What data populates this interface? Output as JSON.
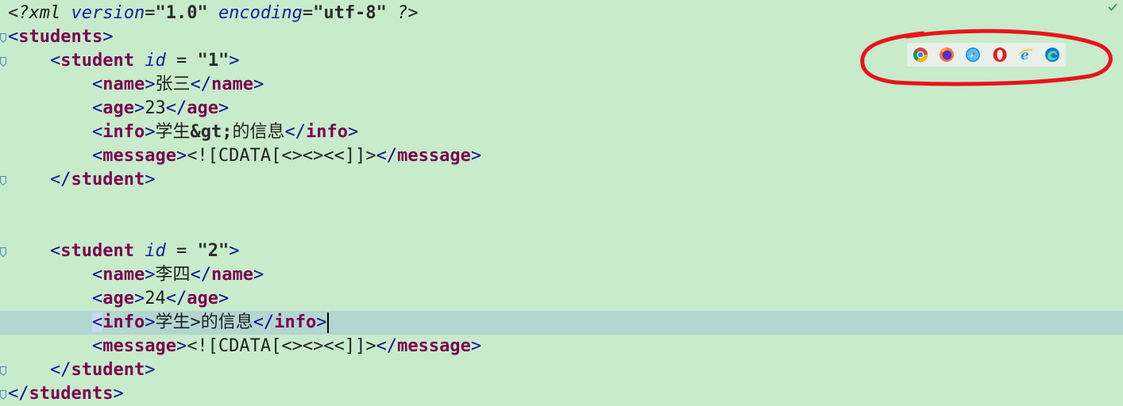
{
  "editor": {
    "lines": [
      {
        "kind": "decl",
        "text": "<?xml version=\"1.0\" encoding=\"utf-8\" ?>"
      },
      {
        "kind": "open",
        "indent": "",
        "tag": "students",
        "text": "<students>"
      },
      {
        "kind": "open_attr",
        "indent": "    ",
        "tag": "student",
        "attr": "id",
        "value": "\"1\"",
        "text": "<student id = \"1\">"
      },
      {
        "kind": "elem",
        "indent": "        ",
        "tag": "name",
        "content": "张三",
        "text": "<name>张三</name>"
      },
      {
        "kind": "elem",
        "indent": "        ",
        "tag": "age",
        "content": "23",
        "text": "<age>23</age>"
      },
      {
        "kind": "elem_ent",
        "indent": "        ",
        "tag": "info",
        "pre": "学生",
        "entity": "&gt;",
        "post": "的信息",
        "text": "<info>学生&gt;的信息</info>"
      },
      {
        "kind": "elem",
        "indent": "        ",
        "tag": "message",
        "content": "<![CDATA[<><><<]]>",
        "text": "<message><![CDATA[<><><<]]></message>"
      },
      {
        "kind": "close",
        "indent": "    ",
        "tag": "student",
        "text": "</student>"
      },
      {
        "kind": "blank",
        "text": ""
      },
      {
        "kind": "blank",
        "text": ""
      },
      {
        "kind": "open_attr",
        "indent": "    ",
        "tag": "student",
        "attr": "id",
        "value": "\"2\"",
        "text": "<student id = \"2\">"
      },
      {
        "kind": "elem",
        "indent": "        ",
        "tag": "name",
        "content": "李四",
        "text": "<name>李四</name>"
      },
      {
        "kind": "elem",
        "indent": "        ",
        "tag": "age",
        "content": "24",
        "text": "<age>24</age>"
      },
      {
        "kind": "elem",
        "indent": "        ",
        "tag": "info",
        "content": "学生>的信息",
        "current": true,
        "text": "<info>学生>的信息</info>"
      },
      {
        "kind": "elem",
        "indent": "        ",
        "tag": "message",
        "content": "<![CDATA[<><><<]]>",
        "text": "<message><![CDATA[<><><<]]></message>"
      },
      {
        "kind": "close",
        "indent": "    ",
        "tag": "student",
        "text": "</student>"
      },
      {
        "kind": "close",
        "indent": "",
        "tag": "students",
        "text": "</students>"
      }
    ]
  },
  "browsers": [
    {
      "name": "chrome-icon",
      "color": "#db4437"
    },
    {
      "name": "firefox-icon",
      "color": "#ff7139"
    },
    {
      "name": "safari-icon",
      "color": "#1e88e5"
    },
    {
      "name": "opera-icon",
      "color": "#e0201b"
    },
    {
      "name": "ie-icon",
      "color": "#1ea0e8"
    },
    {
      "name": "edge-icon",
      "color": "#0c7bd4"
    }
  ],
  "colors": {
    "background": "#c7ebcb",
    "current_line": "#b3d6d1",
    "tag_name": "#7a0552",
    "bracket": "#0f0f8c",
    "attribute": "#1c1c9e",
    "annotation": "#e8141b"
  },
  "status": {
    "check": "check-icon"
  }
}
